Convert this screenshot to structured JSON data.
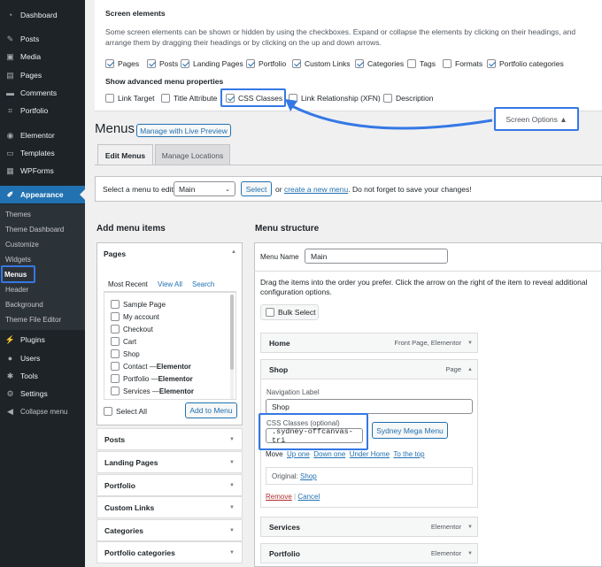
{
  "sidebar": {
    "items": [
      {
        "label": "Dashboard",
        "icon": "dashboard-icon"
      },
      {
        "label": "Posts",
        "icon": "pin-icon"
      },
      {
        "label": "Media",
        "icon": "media-icon"
      },
      {
        "label": "Pages",
        "icon": "pages-icon"
      },
      {
        "label": "Comments",
        "icon": "comment-icon"
      },
      {
        "label": "Portfolio",
        "icon": "portfolio-icon"
      },
      {
        "label": "Elementor",
        "icon": "elementor-icon"
      },
      {
        "label": "Templates",
        "icon": "templates-icon"
      },
      {
        "label": "WPForms",
        "icon": "wpforms-icon"
      },
      {
        "label": "Appearance",
        "icon": "brush-icon"
      },
      {
        "label": "Plugins",
        "icon": "plugin-icon"
      },
      {
        "label": "Users",
        "icon": "users-icon"
      },
      {
        "label": "Tools",
        "icon": "wrench-icon"
      },
      {
        "label": "Settings",
        "icon": "settings-icon"
      },
      {
        "label": "Collapse menu",
        "icon": "collapse-icon"
      }
    ],
    "submenu": [
      "Themes",
      "Theme Dashboard",
      "Customize",
      "Widgets",
      "Menus",
      "Header",
      "Background",
      "Theme File Editor"
    ]
  },
  "screen_options": {
    "title": "Screen elements",
    "description": "Some screen elements can be shown or hidden by using the checkboxes. Expand or collapse the elements by clicking on their headings, and arrange them by dragging their headings or by clicking on the up and down arrows.",
    "elements": [
      {
        "label": "Pages",
        "checked": true
      },
      {
        "label": "Posts",
        "checked": true
      },
      {
        "label": "Landing Pages",
        "checked": true
      },
      {
        "label": "Portfolio",
        "checked": true
      },
      {
        "label": "Custom Links",
        "checked": true
      },
      {
        "label": "Categories",
        "checked": true
      },
      {
        "label": "Tags",
        "checked": false
      },
      {
        "label": "Formats",
        "checked": false
      },
      {
        "label": "Portfolio categories",
        "checked": true
      }
    ],
    "advanced_title": "Show advanced menu properties",
    "advanced": [
      {
        "label": "Link Target",
        "checked": false
      },
      {
        "label": "Title Attribute",
        "checked": false
      },
      {
        "label": "CSS Classes",
        "checked": true
      },
      {
        "label": "Link Relationship (XFN)",
        "checked": false
      },
      {
        "label": "Description",
        "checked": false
      }
    ],
    "toggle_label": "Screen Options ▲"
  },
  "page": {
    "title": "Menus",
    "live_preview": "Manage with Live Preview",
    "tabs": [
      "Edit Menus",
      "Manage Locations"
    ]
  },
  "manage": {
    "prefix": "Select a menu to edit:",
    "selected_menu": "Main",
    "select_button": "Select",
    "or": "or",
    "create_link": "create a new menu",
    "suffix": ". Do not forget to save your changes!"
  },
  "add_items": {
    "heading": "Add menu items",
    "pages_title": "Pages",
    "tabs": [
      "Most Recent",
      "View All",
      "Search"
    ],
    "pages": [
      {
        "name": "Sample Page",
        "suffix": ""
      },
      {
        "name": "My account",
        "suffix": ""
      },
      {
        "name": "Checkout",
        "suffix": ""
      },
      {
        "name": "Cart",
        "suffix": ""
      },
      {
        "name": "Shop",
        "suffix": ""
      },
      {
        "name": "Contact — ",
        "suffix": "Elementor"
      },
      {
        "name": "Portfolio — ",
        "suffix": "Elementor"
      },
      {
        "name": "Services — ",
        "suffix": "Elementor"
      }
    ],
    "select_all": "Select All",
    "add_button": "Add to Menu",
    "sections": [
      "Posts",
      "Landing Pages",
      "Portfolio",
      "Custom Links",
      "Categories",
      "Portfolio categories"
    ]
  },
  "structure": {
    "heading": "Menu structure",
    "name_label": "Menu Name",
    "name_value": "Main",
    "instructions": "Drag the items into the order you prefer. Click the arrow on the right of the item to reveal additional configuration options.",
    "bulk_select": "Bulk Select",
    "items": [
      {
        "title": "Home",
        "meta": "Front Page, Elementor"
      },
      {
        "title": "Shop",
        "meta": "Page"
      },
      {
        "title": "Services",
        "meta": "Elementor"
      },
      {
        "title": "Portfolio",
        "meta": "Elementor"
      }
    ],
    "shop": {
      "nav_label": "Navigation Label",
      "nav_value": "Shop",
      "css_label": "CSS Classes (optional)",
      "css_value": ".sydney-offcanvas-tri",
      "mega_menu": "Sydney Mega Menu",
      "move": "Move",
      "up_one": "Up one",
      "down_one": "Down one",
      "under_home": "Under Home",
      "to_top": "To the top",
      "original_label": "Original:",
      "original_link": "Shop",
      "remove": "Remove",
      "separator": "|",
      "cancel": "Cancel"
    }
  },
  "colors": {
    "highlight": "#3578e5",
    "link": "#2271b1",
    "admin_bg": "#1d2327",
    "remove": "#b32d2e"
  }
}
